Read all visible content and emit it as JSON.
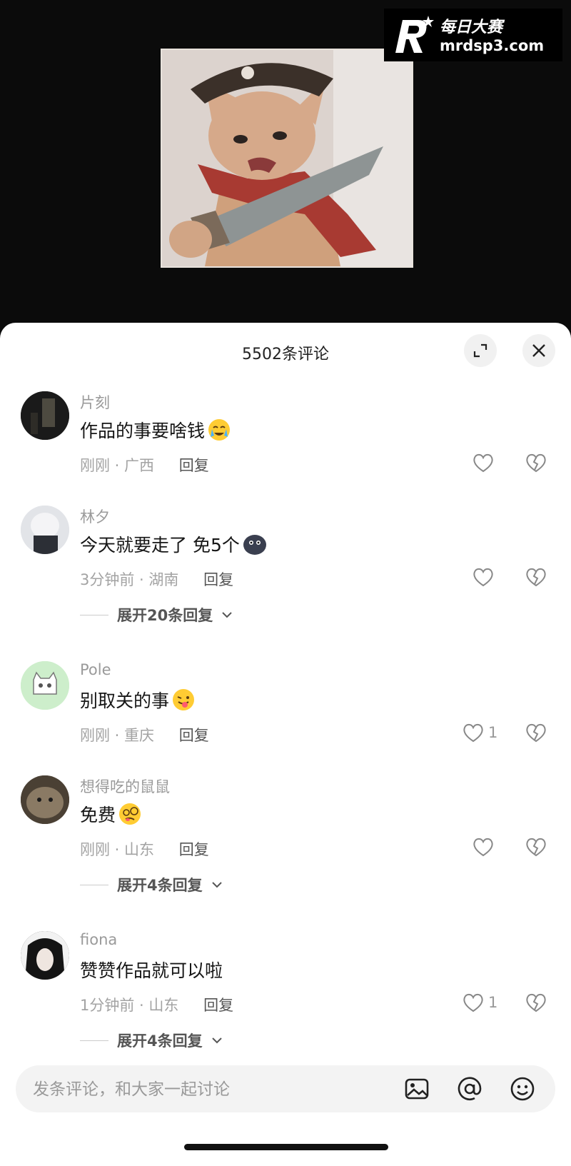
{
  "watermark": {
    "line1": "每日大赛",
    "line2": "mrdsp3.com",
    "logo_icon": "r-star-logo"
  },
  "sheet": {
    "title": "5502条评论",
    "expand_icon": "expand-icon",
    "close_icon": "close-icon"
  },
  "comments": [
    {
      "user": "片刻",
      "text": "作品的事要啥钱",
      "emoji": "crying-emoji",
      "meta": "刚刚 · 广西",
      "reply": "回复",
      "likes": ""
    },
    {
      "user": "林夕",
      "text": "今天就要走了  免5个",
      "emoji": "dark-blob-emoji",
      "meta": "3分钟前 · 湖南",
      "reply": "回复",
      "likes": "",
      "expand": "展开20条回复"
    },
    {
      "user": "Pole",
      "text": "别取关的事",
      "emoji": "wink-tongue-emoji",
      "meta": "刚刚 · 重庆",
      "reply": "回复",
      "likes": "1"
    },
    {
      "user": "想得吃的鼠鼠",
      "text": "免费",
      "emoji": "dizzy-emoji",
      "meta": "刚刚 · 山东",
      "reply": "回复",
      "likes": "",
      "expand": "展开4条回复"
    },
    {
      "user": "fiona",
      "text": "赞赞作品就可以啦",
      "emoji": "",
      "meta": "1分钟前 · 山东",
      "reply": "回复",
      "likes": "1",
      "expand": "展开4条回复"
    }
  ],
  "input": {
    "placeholder": "发条评论，和大家一起讨论",
    "icons": [
      "image-icon",
      "at-icon",
      "emoji-icon"
    ]
  },
  "colors": {
    "sheet_bg": "#ffffff",
    "video_bg": "#0b0b0b",
    "text_gray": "#9a9a9a"
  }
}
